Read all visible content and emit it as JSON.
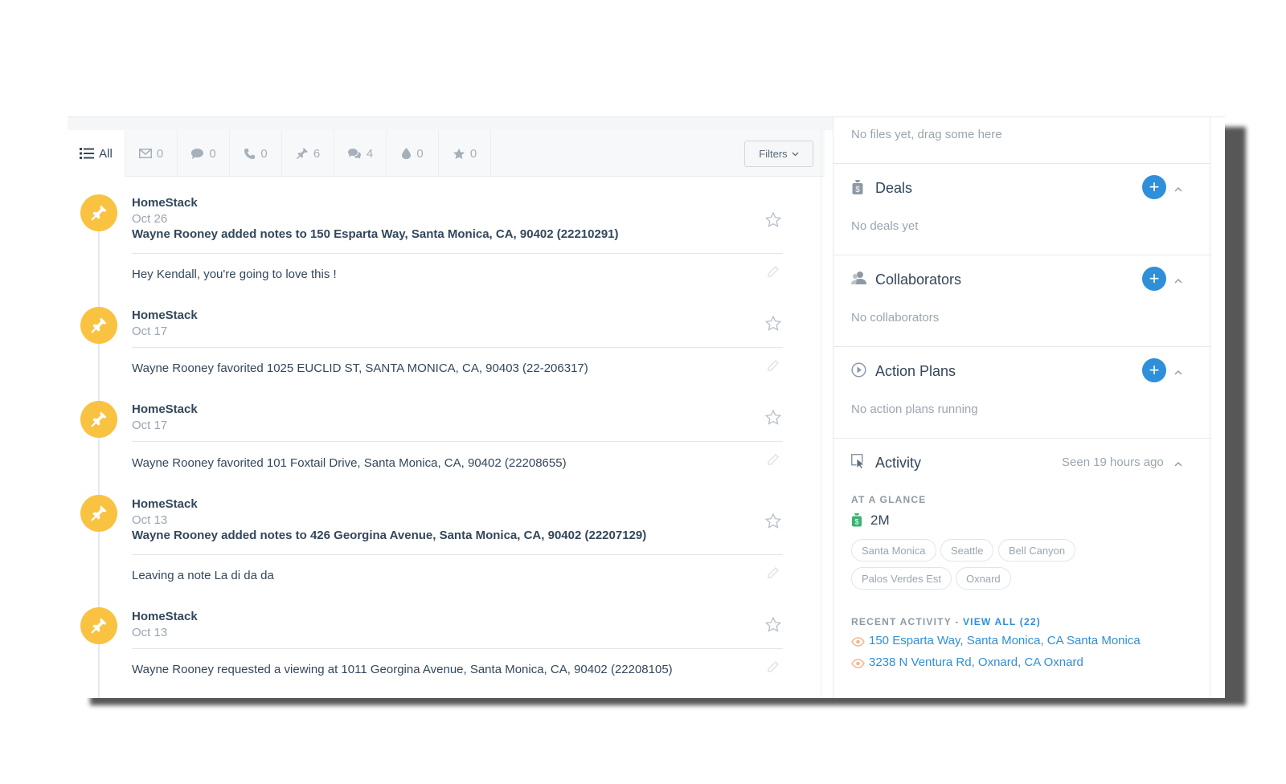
{
  "tabs": [
    {
      "label": "All",
      "icon": "list-icon"
    },
    {
      "label": "0",
      "icon": "email-icon"
    },
    {
      "label": "0",
      "icon": "chat-icon"
    },
    {
      "label": "0",
      "icon": "phone-icon"
    },
    {
      "label": "6",
      "icon": "pin-icon"
    },
    {
      "label": "4",
      "icon": "conversation-icon"
    },
    {
      "label": "0",
      "icon": "drop-icon"
    },
    {
      "label": "0",
      "icon": "star-icon"
    }
  ],
  "filters_label": "Filters",
  "feed": [
    {
      "source": "HomeStack",
      "date": "Oct 26",
      "headline": "Wayne Rooney added notes to 150 Esparta Way, Santa Monica, CA, 90402 (22210291)",
      "body": "Hey Kendall, you're going to love this !"
    },
    {
      "source": "HomeStack",
      "date": "Oct 17",
      "headline": "",
      "body": "Wayne Rooney favorited 1025 EUCLID ST, SANTA MONICA, CA, 90403 (22-206317)"
    },
    {
      "source": "HomeStack",
      "date": "Oct 17",
      "headline": "",
      "body": "Wayne Rooney favorited 101 Foxtail Drive, Santa Monica, CA, 90402 (22208655)"
    },
    {
      "source": "HomeStack",
      "date": "Oct 13",
      "headline": "Wayne Rooney added notes to 426 Georgina Avenue, Santa Monica, CA, 90402 (22207129)",
      "body": "Leaving a note La di da da"
    },
    {
      "source": "HomeStack",
      "date": "Oct 13",
      "headline": "",
      "body": "Wayne Rooney requested a viewing at 1011 Georgina Avenue, Santa Monica, CA, 90402 (22208105)"
    }
  ],
  "sidebar": {
    "files_empty": "No files yet, drag some here",
    "deals": {
      "title": "Deals",
      "empty": "No deals yet"
    },
    "collaborators": {
      "title": "Collaborators",
      "empty": "No collaborators"
    },
    "action_plans": {
      "title": "Action Plans",
      "empty": "No action plans running"
    },
    "activity": {
      "title": "Activity",
      "seen": "Seen 19 hours ago",
      "at_a_glance_label": "AT A GLANCE",
      "price": "2M",
      "chips": [
        "Santa Monica",
        "Seattle",
        "Bell Canyon",
        "Palos Verdes Est",
        "Oxnard"
      ],
      "recent_label": "RECENT ACTIVITY - ",
      "view_all": "VIEW ALL (22)",
      "recent_items": [
        "150 Esparta Way, Santa Monica, CA Santa Monica",
        "3238 N Ventura Rd, Oxnard, CA Oxnard"
      ]
    }
  },
  "colors": {
    "accent": "#2f8fd8",
    "pin": "#f9c241",
    "text": "#33475b",
    "muted": "#9aa5b0"
  }
}
